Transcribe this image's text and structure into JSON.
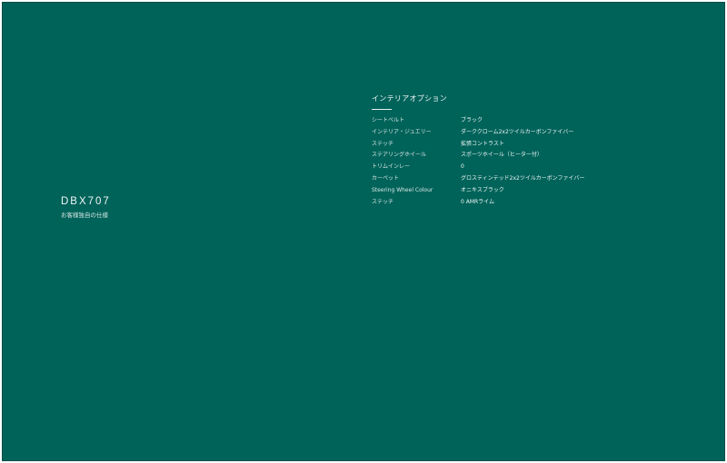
{
  "model": {
    "name": "DBX707",
    "subtitle": "お客様独自の仕様"
  },
  "interior_options": {
    "title": "インテリアオプション",
    "rows": [
      {
        "label": "シートベルト",
        "value": "ブラック"
      },
      {
        "label": "インテリア・ジュエリー",
        "value": "ダーククローム2x2ツイルカーボンファイバー"
      },
      {
        "label": "ステッチ",
        "value": "拡張コントラスト"
      },
      {
        "label": "ステアリングホイール",
        "value": "スポーツホイール（ヒーター付）"
      },
      {
        "label": "トリムインレー",
        "value": "0"
      },
      {
        "label": "カーペット",
        "value": "グロスティンテッド2x2ツイルカーボンファイバー"
      },
      {
        "label": "Steering Wheel Colour",
        "value": "オニキスブラック"
      },
      {
        "label": "ステッチ",
        "value": "0 AMRライム"
      }
    ]
  },
  "colors": {
    "background": "#00635a",
    "text": "#e9f1ef"
  }
}
